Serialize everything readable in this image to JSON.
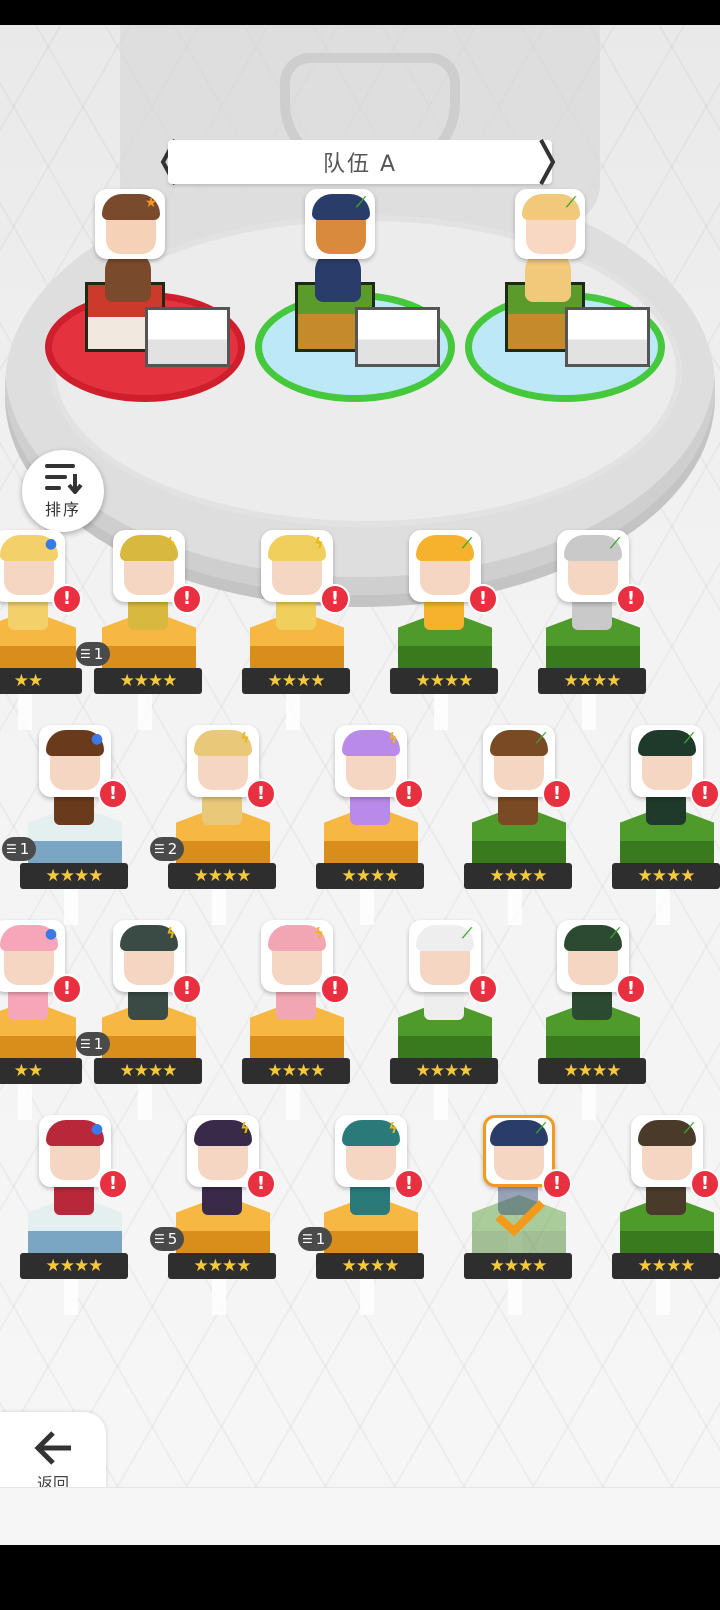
{
  "team": {
    "title": "队伍 A"
  },
  "sort": {
    "label": "排序"
  },
  "back": {
    "label": "返回"
  },
  "colors": {
    "gold": "#f6b843",
    "green": "#4e9a2a",
    "red": "#e5323f",
    "alert": "#e83040",
    "star": "#f6c93a",
    "select": "#f29a1c"
  },
  "team_slots": [
    {
      "element": "star-cards",
      "platform": "red",
      "hair": "#7a4a2c",
      "skin": "#f5d1b8"
    },
    {
      "element": "leaf",
      "platform": "green",
      "hair": "#2a3d6a",
      "skin": "#d98a3c"
    },
    {
      "element": "leaf",
      "platform": "green",
      "hair": "#f2c87a",
      "skin": "#f8d8c2"
    }
  ],
  "roster": [
    {
      "element": "water",
      "block": "gold",
      "hair": "#f4d06a",
      "stars": "★★",
      "count": "",
      "alert": "!"
    },
    {
      "element": "thunder",
      "block": "gold",
      "hair": "#d9b840",
      "stars": "★★★★",
      "count": "1",
      "alert": "!"
    },
    {
      "element": "thunder",
      "block": "gold",
      "hair": "#f0cf5c",
      "stars": "★★★★",
      "count": "",
      "alert": "!"
    },
    {
      "element": "leaf",
      "block": "green",
      "hair": "#f6b22c",
      "stars": "★★★★",
      "count": "",
      "alert": "!"
    },
    {
      "element": "leaf",
      "block": "green",
      "hair": "#c9c9c9",
      "stars": "★★★★",
      "count": "",
      "alert": "!"
    },
    {
      "element": "water",
      "block": "ice",
      "hair": "#6a3a1c",
      "stars": "★★★★",
      "count": "1",
      "alert": "!"
    },
    {
      "element": "thunder",
      "block": "gold",
      "hair": "#e9c87a",
      "stars": "★★★★",
      "count": "2",
      "alert": "!"
    },
    {
      "element": "thunder",
      "block": "gold",
      "hair": "#b98ae9",
      "stars": "★★★★",
      "count": "",
      "alert": "!"
    },
    {
      "element": "leaf",
      "block": "green",
      "hair": "#7a4a24",
      "stars": "★★★★",
      "count": "",
      "alert": "!"
    },
    {
      "element": "leaf",
      "block": "green",
      "hair": "#1f3a2a",
      "stars": "★★★★",
      "count": "",
      "alert": "!"
    },
    {
      "element": "water",
      "block": "gold",
      "hair": "#f6a6b8",
      "stars": "★★",
      "count": "",
      "alert": "!"
    },
    {
      "element": "thunder",
      "block": "gold",
      "hair": "#3a4a44",
      "stars": "★★★★",
      "count": "1",
      "alert": "!"
    },
    {
      "element": "thunder",
      "block": "gold",
      "hair": "#f2a6b4",
      "stars": "★★★★",
      "count": "",
      "alert": "!"
    },
    {
      "element": "leaf",
      "block": "green",
      "hair": "#eeeeee",
      "stars": "★★★★",
      "count": "",
      "alert": "!"
    },
    {
      "element": "leaf",
      "block": "green",
      "hair": "#2c4a32",
      "stars": "★★★★",
      "count": "",
      "alert": "!"
    },
    {
      "element": "water",
      "block": "ice",
      "hair": "#b8283a",
      "stars": "★★★★",
      "count": "",
      "alert": "!"
    },
    {
      "element": "thunder",
      "block": "gold",
      "hair": "#3a2a4a",
      "stars": "★★★★",
      "count": "5",
      "alert": "!"
    },
    {
      "element": "thunder",
      "block": "gold",
      "hair": "#2a7a7a",
      "stars": "★★★★",
      "count": "1",
      "alert": "!"
    },
    {
      "element": "leaf",
      "block": "green",
      "hair": "#2a3d6a",
      "stars": "★★★★",
      "count": "",
      "alert": "!",
      "selected": true
    },
    {
      "element": "leaf",
      "block": "green",
      "hair": "#4a3a2a",
      "stars": "★★★★",
      "count": "",
      "alert": "!"
    }
  ]
}
